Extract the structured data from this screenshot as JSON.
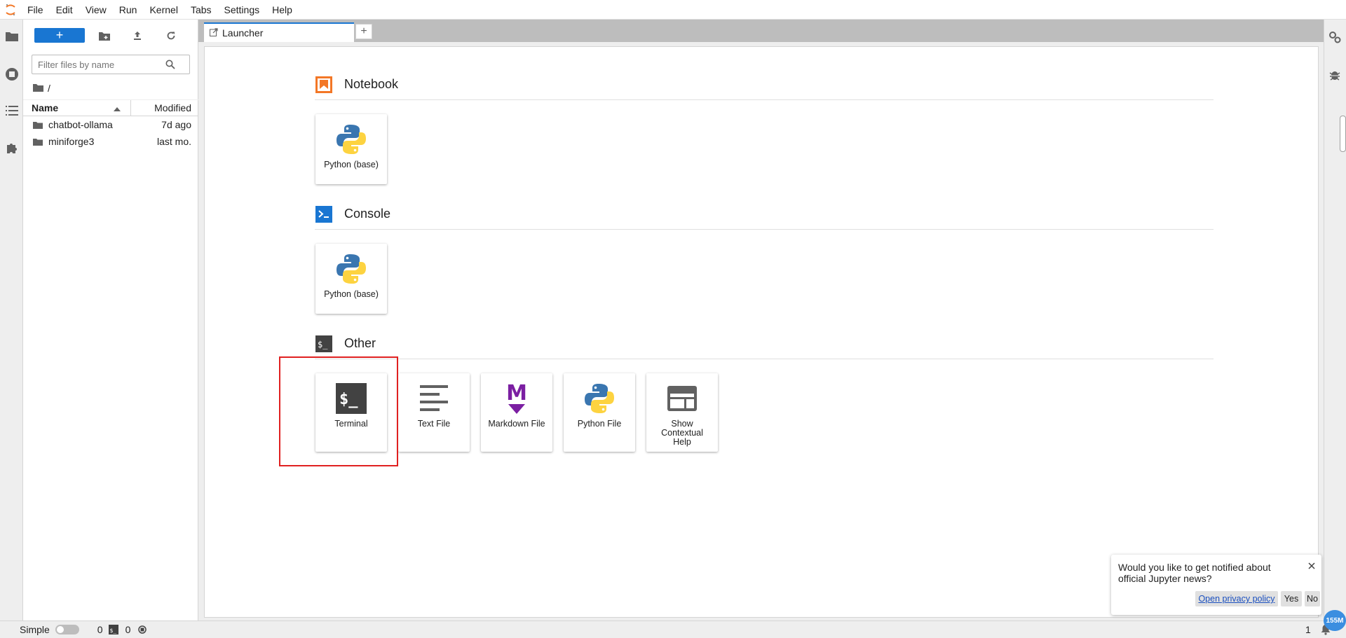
{
  "menubar": {
    "items": [
      "File",
      "Edit",
      "View",
      "Run",
      "Kernel",
      "Tabs",
      "Settings",
      "Help"
    ]
  },
  "filebrowser": {
    "new_label": "+",
    "filter_placeholder": "Filter files by name",
    "breadcrumb": "/",
    "header": {
      "name": "Name",
      "modified": "Modified"
    },
    "rows": [
      {
        "name": "chatbot-ollama",
        "modified": "7d ago"
      },
      {
        "name": "miniforge3",
        "modified": "last mo."
      }
    ]
  },
  "tabs": {
    "launcher_label": "Launcher",
    "add_label": "+"
  },
  "launcher": {
    "sections": [
      {
        "title": "Notebook",
        "cards": [
          {
            "label": "Python (base)",
            "icon": "python-icon"
          }
        ]
      },
      {
        "title": "Console",
        "cards": [
          {
            "label": "Python (base)",
            "icon": "python-icon"
          }
        ]
      },
      {
        "title": "Other",
        "cards": [
          {
            "label": "Terminal",
            "icon": "terminal-icon"
          },
          {
            "label": "Text File",
            "icon": "text-file-icon"
          },
          {
            "label": "Markdown File",
            "icon": "markdown-icon"
          },
          {
            "label": "Python File",
            "icon": "python-icon"
          },
          {
            "label": "Show Contextual Help",
            "icon": "contextual-help-icon"
          }
        ]
      }
    ],
    "highlight_color": "#e02020"
  },
  "statusbar": {
    "mode_label": "Simple",
    "kernels_count": "0",
    "terminals_count": "0",
    "right_count": "1"
  },
  "toast": {
    "message": "Would you like to get notified about official Jupyter news?",
    "privacy_label": "Open privacy policy",
    "yes_label": "Yes",
    "no_label": "No"
  },
  "memory_badge": "155M",
  "colors": {
    "accent": "#1976d2",
    "notebook_orange": "#f37726",
    "markdown_purple": "#7b1fa2"
  }
}
